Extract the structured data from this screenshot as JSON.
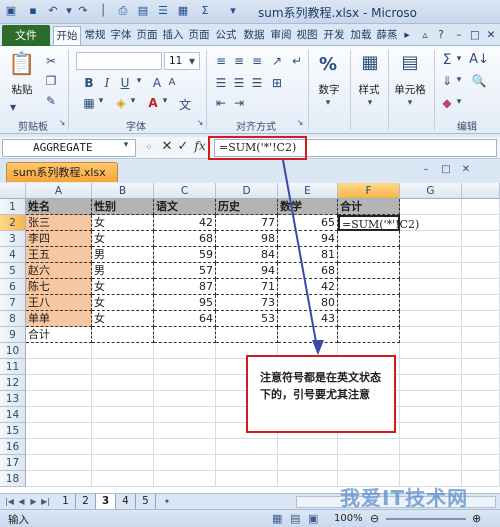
{
  "app": {
    "title": "sum系列教程.xlsx - Microso",
    "name_box": "AGGREGATE",
    "formula": "=SUM('*'!C2)",
    "workbook_tab": "sum系列教程.xlsx"
  },
  "ribbon": {
    "tabs": [
      "文件",
      "开始",
      "常规",
      "字体",
      "页面",
      "插入",
      "页面",
      "公式",
      "数据",
      "审阅",
      "视图",
      "开发",
      "加载",
      "薛蒸"
    ],
    "clipboard": {
      "paste": "粘贴",
      "group": "剪贴板"
    },
    "font": {
      "size": "11",
      "bold": "B",
      "italic": "I",
      "underline": "U",
      "group": "字体",
      "font_color": "A",
      "grow": "A",
      "shrink": "A"
    },
    "align": {
      "group": "对齐方式"
    },
    "number": {
      "percent": "%",
      "label": "数字"
    },
    "styles": {
      "label": "样式"
    },
    "cells": {
      "label": "单元格"
    },
    "editing": {
      "group": "编辑",
      "sigma": "Σ"
    }
  },
  "grid": {
    "columns": [
      "A",
      "B",
      "C",
      "D",
      "E",
      "F",
      "G"
    ],
    "rows": [
      "1",
      "2",
      "3",
      "4",
      "5",
      "6",
      "7",
      "8",
      "9",
      "10",
      "11",
      "12",
      "13",
      "14",
      "15",
      "16",
      "17",
      "18"
    ],
    "header": [
      "姓名",
      "性别",
      "语文",
      "历史",
      "数学",
      "合计"
    ],
    "data": [
      [
        "张三",
        "女",
        "42",
        "77",
        "65",
        "=SUM('*'!C2)"
      ],
      [
        "李四",
        "女",
        "68",
        "98",
        "94",
        ""
      ],
      [
        "王五",
        "男",
        "59",
        "84",
        "81",
        ""
      ],
      [
        "赵六",
        "男",
        "57",
        "94",
        "68",
        ""
      ],
      [
        "陈七",
        "女",
        "87",
        "71",
        "42",
        ""
      ],
      [
        "王八",
        "女",
        "95",
        "73",
        "80",
        ""
      ],
      [
        "单单",
        "女",
        "64",
        "53",
        "43",
        ""
      ],
      [
        "合计",
        "",
        "",
        "",
        "",
        ""
      ]
    ]
  },
  "note": "注意符号都是在英文状态下的，引号要尤其注意",
  "sheets": [
    "1",
    "2",
    "3",
    "4",
    "5"
  ],
  "active_sheet": "3",
  "status": {
    "mode": "输入",
    "zoom": "100%"
  },
  "watermark": "我爱IT技术网"
}
